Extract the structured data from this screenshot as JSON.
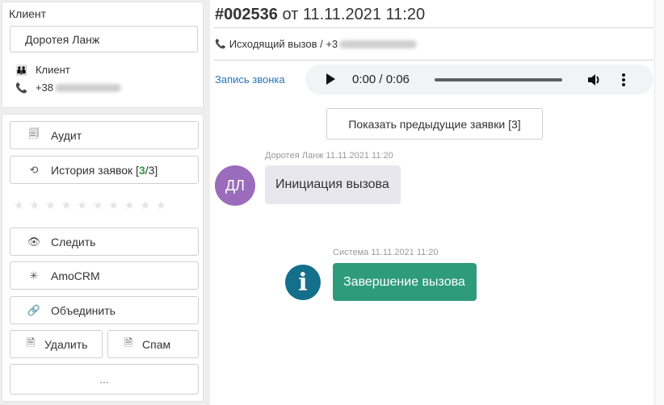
{
  "client": {
    "section_title": "Клиент",
    "name_value": "Доротея Ланж",
    "type_label": "Клиент",
    "phone_prefix": "+38"
  },
  "actions": {
    "audit_label": "Аудит",
    "history_label_prefix": "История заявок [",
    "history_count": "3",
    "history_label_suffix": "/3]",
    "follow_label": "Следить",
    "amocrm_label": "AmoCRM",
    "merge_label": "Объединить",
    "delete_label": "Удалить",
    "spam_label": "Спам",
    "more_label": "..."
  },
  "rating": {
    "stars": 10,
    "value": 0
  },
  "ticket": {
    "number": "#002536",
    "date_text": "от 11.11.2021 11:20",
    "call_info": "Исходящий вызов / +3"
  },
  "recording": {
    "label": "Запись звонка",
    "time": "0:00 / 0:06",
    "progress": 0
  },
  "show_previous_label": "Показать предыдущие заявки [3]",
  "messages": [
    {
      "author_meta": "Доротея Ланж 11.11.2021 11:20",
      "avatar_initials": "ДЛ",
      "text": "Инициация вызова"
    },
    {
      "author_meta": "Система 11.11.2021 11:20",
      "text": "Завершение вызова"
    }
  ],
  "colors": {
    "accent_blue": "#2a74b5",
    "avatar_purple": "#9a6cbb",
    "system_green": "#2e9c78",
    "info_teal": "#136f8a"
  }
}
